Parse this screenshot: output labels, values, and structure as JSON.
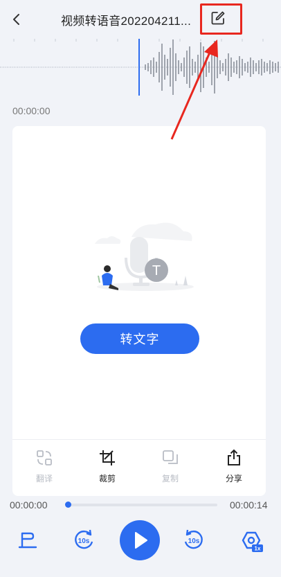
{
  "header": {
    "title": "视频转语音202204211...",
    "back_icon": "chevron-left-icon",
    "edit_icon": "edit-icon"
  },
  "player": {
    "current_time": "00:00:00",
    "start_time": "00:00:00",
    "end_time": "00:00:14",
    "progress_fraction": 0.0
  },
  "main": {
    "convert_label": "转文字"
  },
  "toolbar": {
    "items": [
      {
        "label": "翻译",
        "icon": "translate-icon",
        "enabled": false
      },
      {
        "label": "裁剪",
        "icon": "crop-icon",
        "enabled": true
      },
      {
        "label": "复制",
        "icon": "copy-icon",
        "enabled": false
      },
      {
        "label": "分享",
        "icon": "share-icon",
        "enabled": true
      }
    ]
  },
  "controls": {
    "rewind_label": "10s",
    "forward_label": "10s",
    "speed_label": "1x"
  },
  "colors": {
    "accent": "#2c6cf0",
    "annotation": "#e8271f",
    "background": "#f1f3f8"
  }
}
